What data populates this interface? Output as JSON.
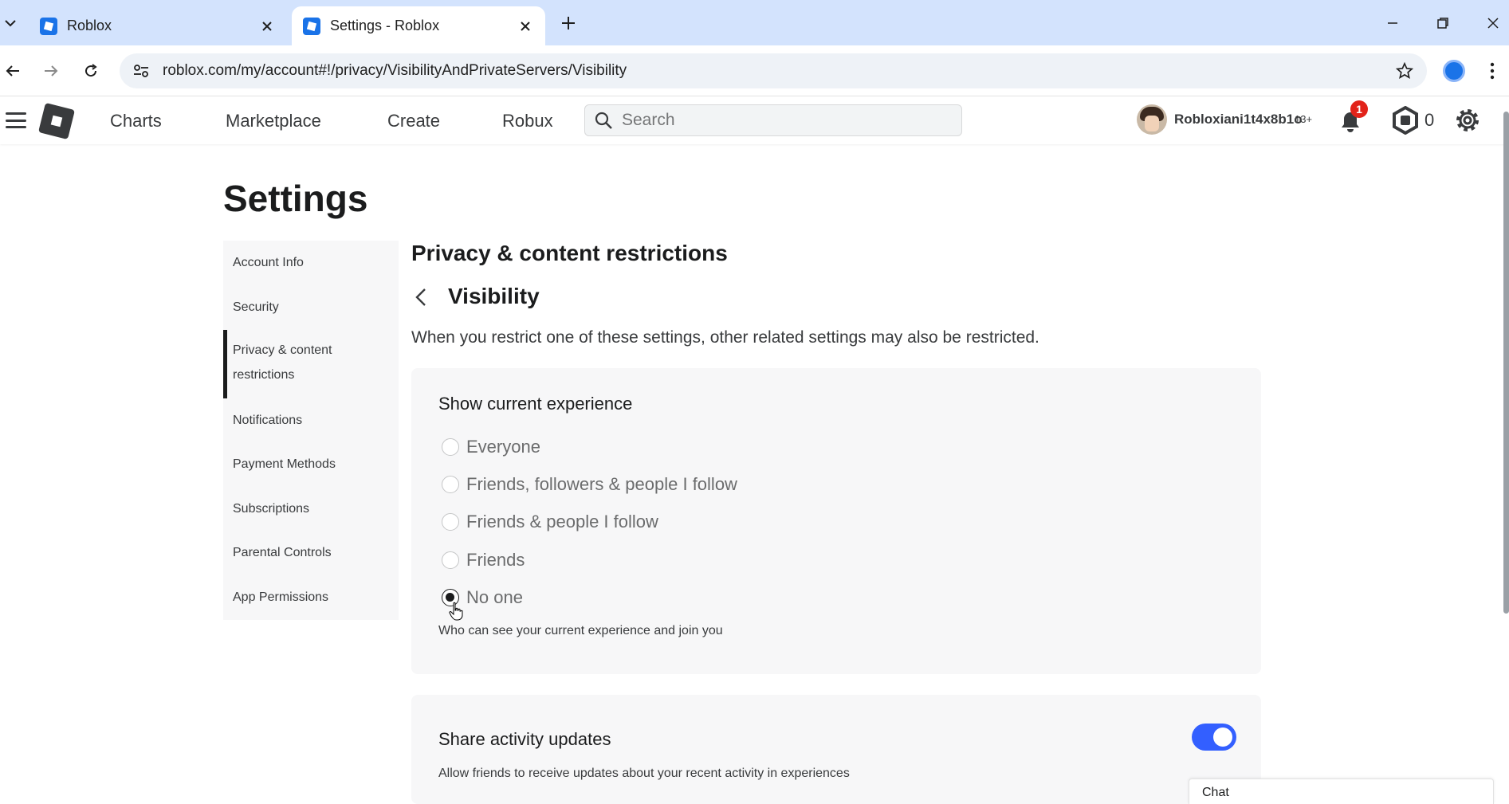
{
  "browser": {
    "tabs": [
      {
        "title": "Roblox",
        "active": false
      },
      {
        "title": "Settings - Roblox",
        "active": true
      }
    ],
    "url": "roblox.com/my/account#!/privacy/VisibilityAndPrivateServers/Visibility"
  },
  "header": {
    "nav": [
      "Charts",
      "Marketplace",
      "Create",
      "Robux"
    ],
    "search_placeholder": "Search",
    "username": "Robloxiani1t4x8b1o",
    "age_badge": "13+",
    "notification_count": "1",
    "robux_balance": "0"
  },
  "page": {
    "title": "Settings",
    "sidebar": {
      "items": [
        {
          "label": "Account Info"
        },
        {
          "label": "Security"
        },
        {
          "label": "Privacy & content restrictions",
          "line1": "Privacy & content",
          "line2": "restrictions",
          "active": true
        },
        {
          "label": "Notifications"
        },
        {
          "label": "Payment Methods"
        },
        {
          "label": "Subscriptions"
        },
        {
          "label": "Parental Controls"
        },
        {
          "label": "App Permissions"
        }
      ]
    },
    "section_title": "Privacy & content restrictions",
    "subsection_title": "Visibility",
    "description": "When you restrict one of these settings, other related settings may also be restricted.",
    "current_experience": {
      "title": "Show current experience",
      "options": [
        "Everyone",
        "Friends, followers & people I follow",
        "Friends & people I follow",
        "Friends",
        "No one"
      ],
      "selected": "No one",
      "helper": "Who can see your current experience and join you"
    },
    "activity_updates": {
      "title": "Share activity updates",
      "helper": "Allow friends to receive updates about your recent activity in experiences",
      "enabled": true
    }
  },
  "chat": {
    "label": "Chat"
  },
  "colors": {
    "tabstrip": "#d3e3fd",
    "toggle_on": "#335fff",
    "badge": "#e2231a",
    "card_bg": "#f7f7f8"
  }
}
